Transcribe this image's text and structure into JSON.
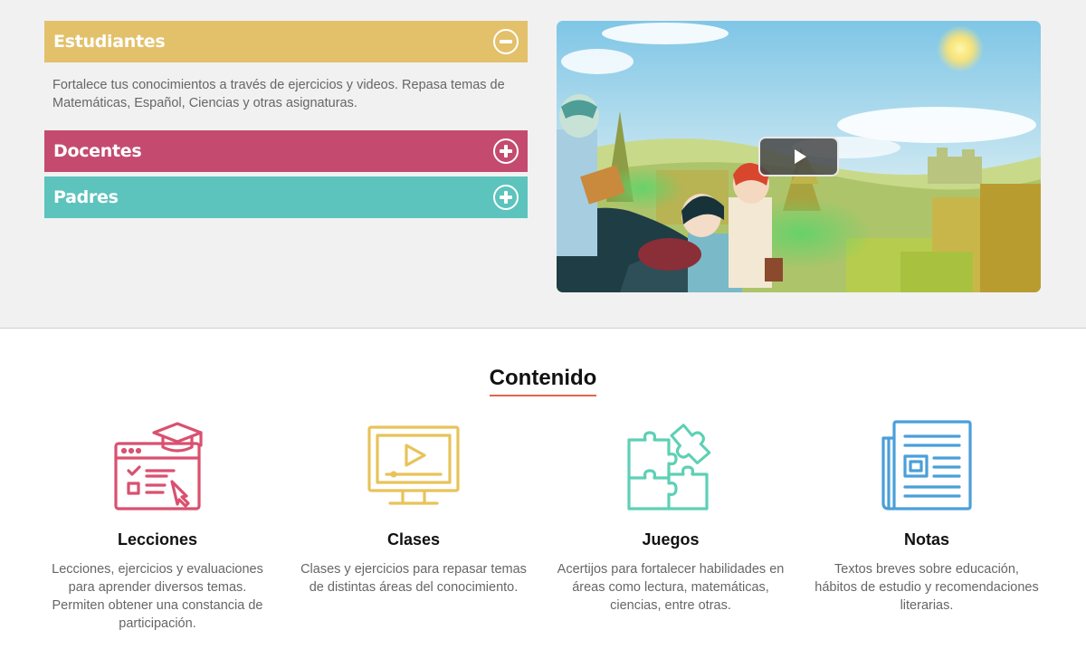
{
  "accordion": {
    "students": {
      "title": "Estudiantes",
      "description": "Fortalece tus conocimientos a través de ejercicios y videos. Repasa temas de Matemáticas, Español, Ciencias y otras asignaturas.",
      "color": "#e3c06a",
      "expanded": true
    },
    "teachers": {
      "title": "Docentes",
      "color": "#c44b6f",
      "expanded": false
    },
    "parents": {
      "title": "Padres",
      "color": "#5cc3bd",
      "expanded": false
    }
  },
  "video": {
    "play_icon": "play-icon"
  },
  "content": {
    "heading": "Contenido",
    "accent": "#e0664a",
    "items": [
      {
        "title": "Lecciones",
        "description": "Lecciones, ejercicios y evaluaciones para aprender diversos temas. Permiten obtener una constancia de participación.",
        "icon": "graduation-cap-browser-icon",
        "color": "#d9516f"
      },
      {
        "title": "Clases",
        "description": "Clases y ejercicios para repasar temas de distintas áreas del conocimiento.",
        "icon": "monitor-play-icon",
        "color": "#e8c35a"
      },
      {
        "title": "Juegos",
        "description": "Acertijos para fortalecer habilidades en áreas como lectura, matemáticas, ciencias, entre otras.",
        "icon": "puzzle-icon",
        "color": "#5dd0b5"
      },
      {
        "title": "Notas",
        "description": "Textos breves sobre educación, hábitos de estudio y recomendaciones literarias.",
        "icon": "newspaper-icon",
        "color": "#4a9fd9"
      }
    ]
  }
}
